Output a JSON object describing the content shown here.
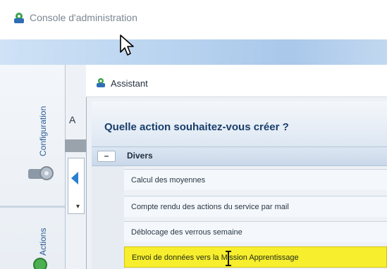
{
  "app": {
    "title": "Console d'administration",
    "icon": "admin-console-icon"
  },
  "sidebar": {
    "tabs": [
      {
        "label": "Configuration",
        "icon": "config-gear-icon"
      },
      {
        "label": "Actions",
        "icon": "actions-icon"
      }
    ]
  },
  "background_window": {
    "tab_label": "A"
  },
  "dialog": {
    "title": "Assistant",
    "icon": "assistant-icon",
    "question": "Quelle action souhaitez-vous créer ?",
    "category": {
      "toggle_label": "–",
      "label": "Divers",
      "items": [
        {
          "label": "Calcul des moyennes",
          "selected": false
        },
        {
          "label": "Compte rendu des actions du service par mail",
          "selected": false
        },
        {
          "label": "Déblocage des verrous semaine",
          "selected": false
        },
        {
          "label": "Envoi de données vers la Mission Apprentissage",
          "selected": true
        }
      ]
    }
  },
  "colors": {
    "ribbon": "#b8d3ef",
    "accent": "#1a3e6b",
    "highlight": "#f7ee2d"
  }
}
